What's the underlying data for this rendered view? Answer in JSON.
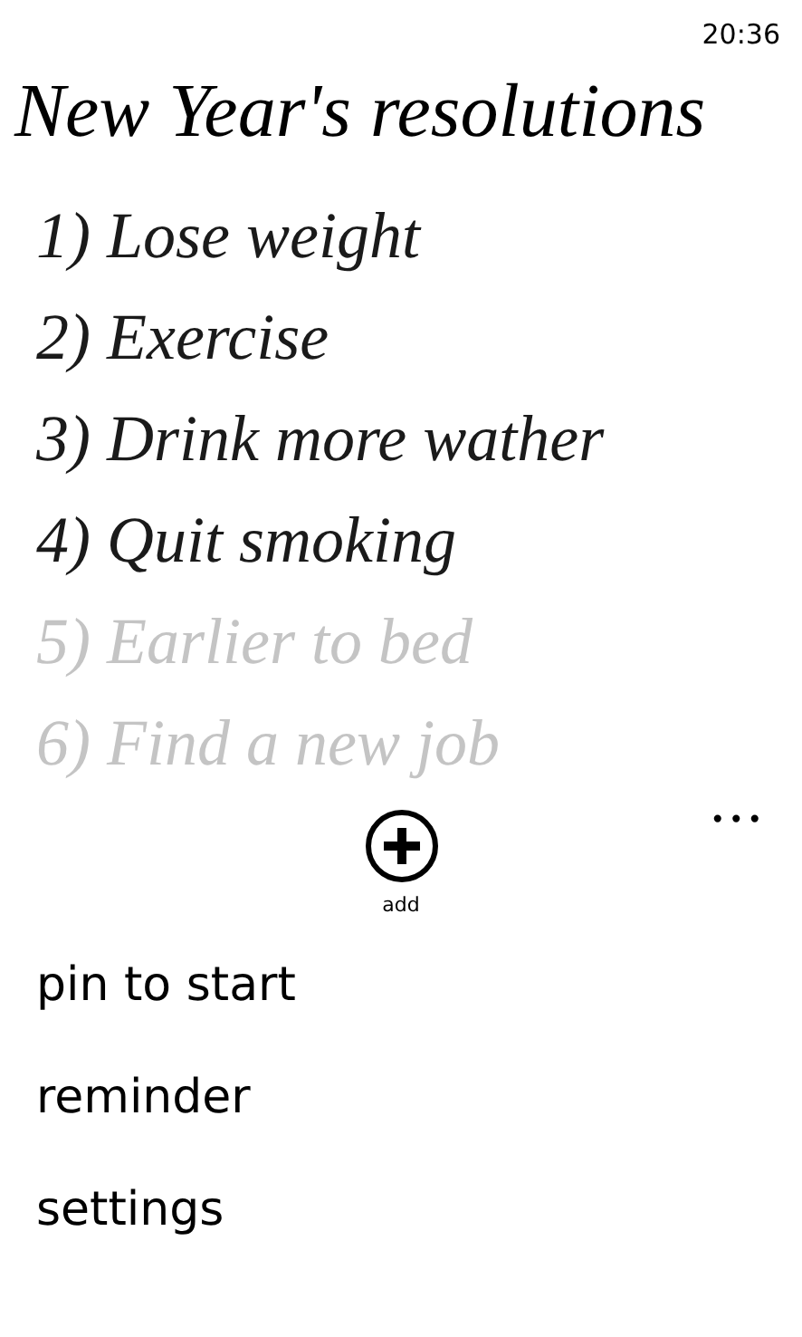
{
  "status_bar": {
    "time": "20:36"
  },
  "title": "New Year's resolutions",
  "items": [
    {
      "text": "1) Lose weight",
      "dimmed": false
    },
    {
      "text": "2) Exercise",
      "dimmed": false
    },
    {
      "text": "3) Drink more wather",
      "dimmed": false
    },
    {
      "text": "4) Quit smoking",
      "dimmed": false
    },
    {
      "text": "5) Earlier to bed",
      "dimmed": true
    },
    {
      "text": "6) Find a new job",
      "dimmed": true
    }
  ],
  "app_bar": {
    "button": {
      "label": "add"
    },
    "more": "•••",
    "menu": [
      "pin to start",
      "reminder",
      "settings"
    ]
  }
}
